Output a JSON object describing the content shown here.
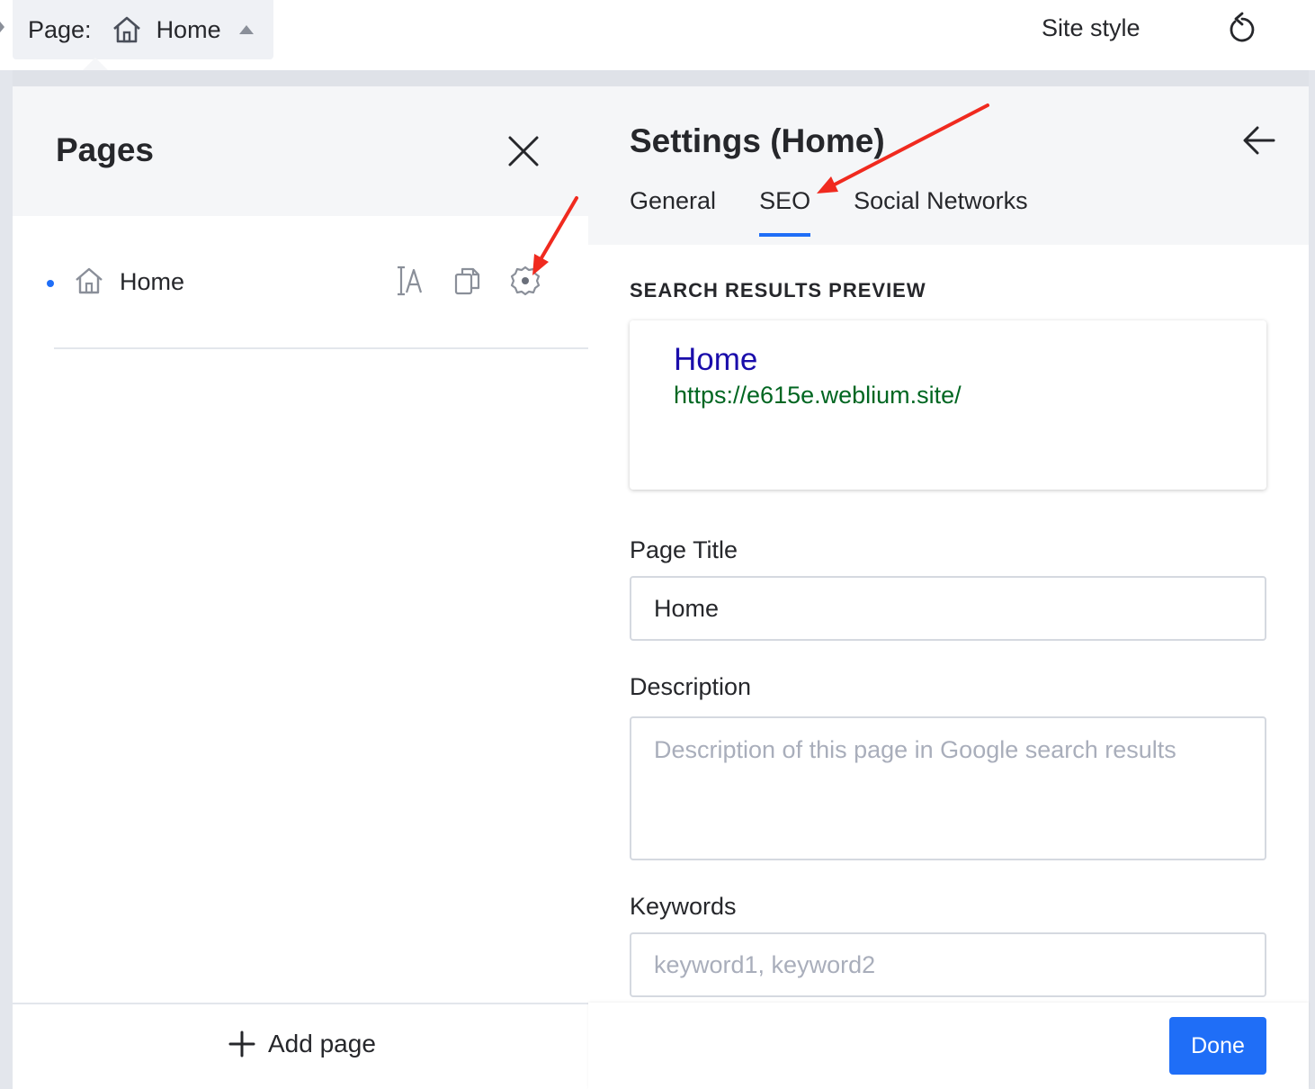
{
  "topbar": {
    "page_label": "Page:",
    "current_page": "Home",
    "site_style": "Site style",
    "icons": [
      "home-icon",
      "caret-up-icon",
      "undo-icon"
    ]
  },
  "pages_panel": {
    "title": "Pages",
    "items": [
      {
        "label": "Home",
        "icons": [
          "home-icon",
          "rename-icon",
          "duplicate-icon",
          "gear-icon"
        ]
      }
    ],
    "add_page": "Add page"
  },
  "settings_panel": {
    "title": "Settings (Home)",
    "tabs": [
      {
        "label": "General",
        "active": false
      },
      {
        "label": "SEO",
        "active": true
      },
      {
        "label": "Social Networks",
        "active": false
      }
    ],
    "preview_heading": "SEARCH RESULTS PREVIEW",
    "preview": {
      "title": "Home",
      "url": "https://e615e.weblium.site/"
    },
    "page_title": {
      "label": "Page Title",
      "value": "Home"
    },
    "description": {
      "label": "Description",
      "value": "",
      "placeholder": "Description of this page in Google search results"
    },
    "keywords": {
      "label": "Keywords",
      "value": "",
      "placeholder": "keyword1, keyword2"
    },
    "done": "Done"
  },
  "colors": {
    "accent": "#1f6ef7",
    "serp_title": "#1a0dab",
    "serp_url": "#006621",
    "annotation_arrow": "#f02a1f"
  }
}
